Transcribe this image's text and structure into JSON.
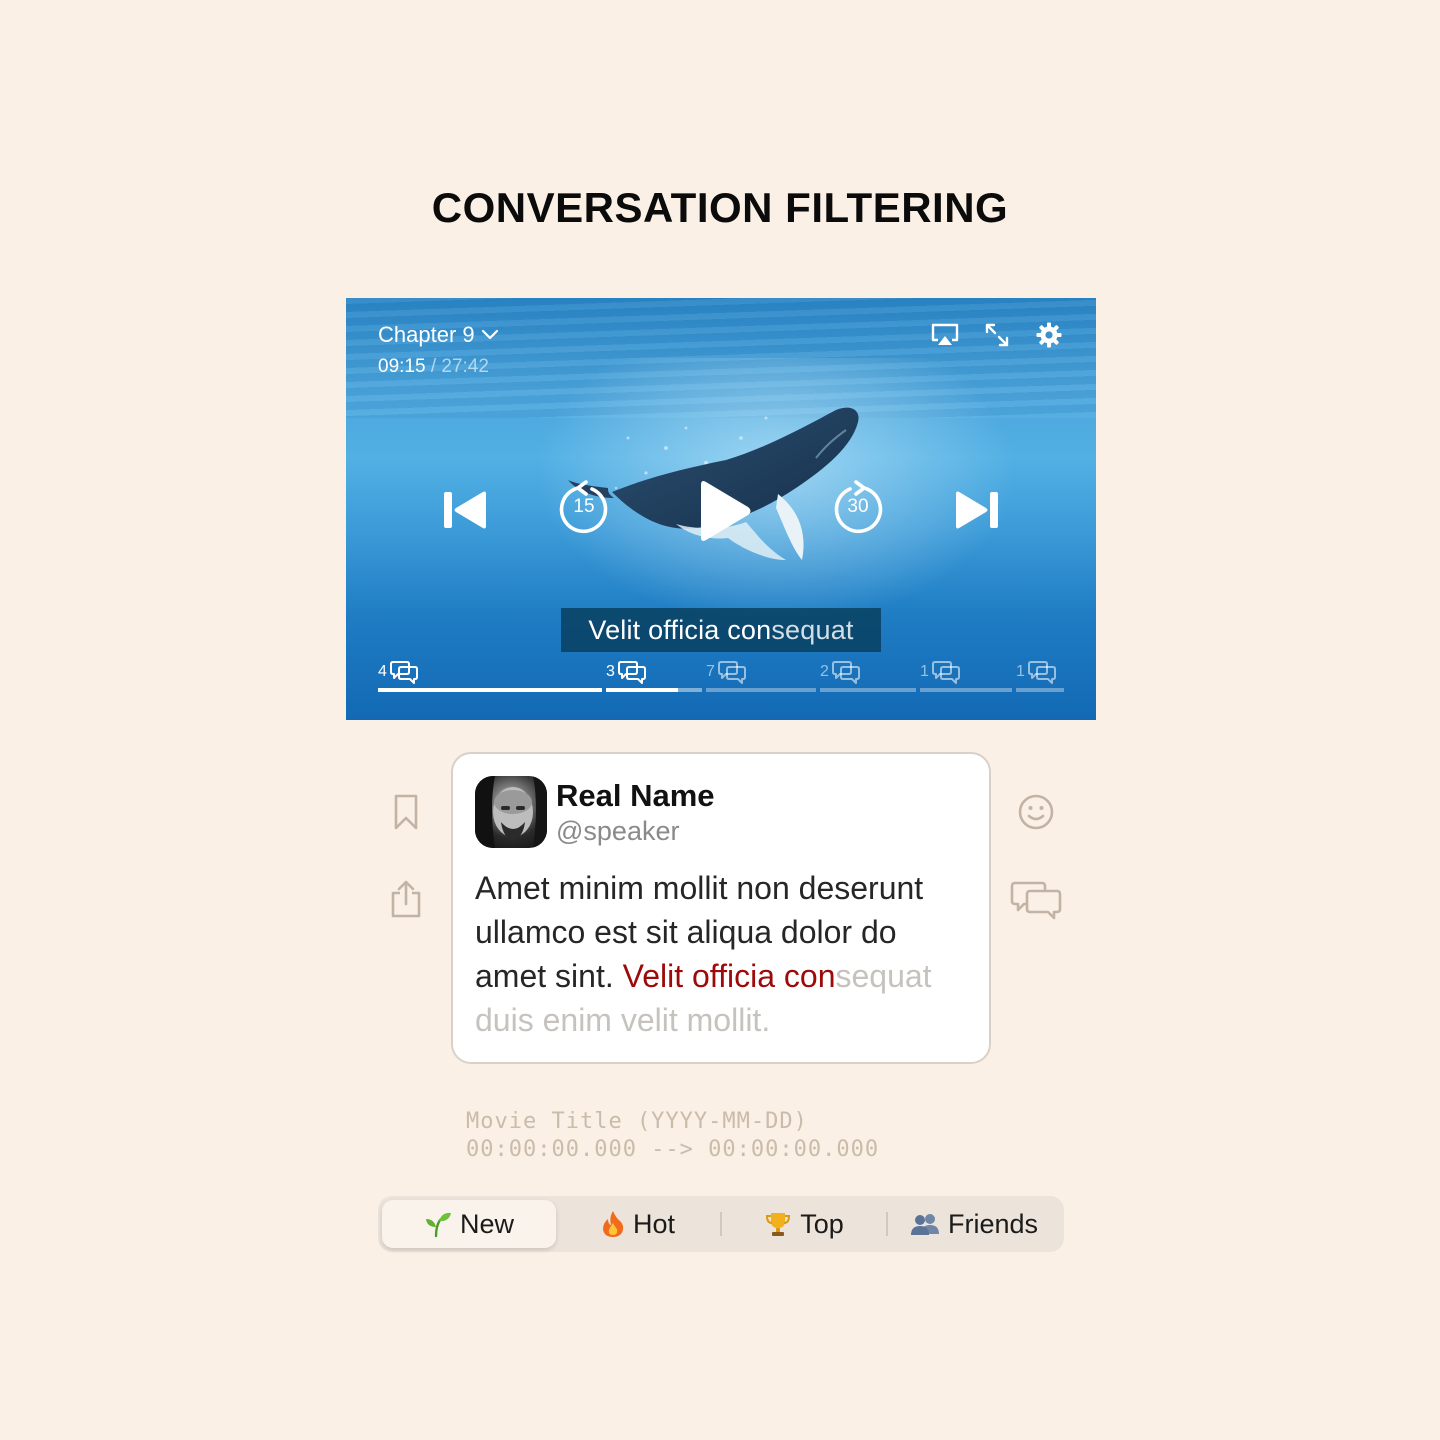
{
  "page": {
    "title": "CONVERSATION FILTERING"
  },
  "player": {
    "chapter_label": "Chapter 9",
    "current_time": "09:15",
    "time_separator": " / ",
    "total_time": "27:42",
    "rewind_seconds": "15",
    "forward_seconds": "30",
    "subtitle_highlight": "Velit officia con",
    "subtitle_rest": "sequat",
    "chapters": [
      {
        "count": "4",
        "state": "done",
        "progress": 1.0
      },
      {
        "count": "3",
        "state": "current",
        "progress": 0.75
      },
      {
        "count": "7",
        "state": "upcoming",
        "progress": 0
      },
      {
        "count": "2",
        "state": "upcoming",
        "progress": 0
      },
      {
        "count": "1",
        "state": "upcoming",
        "progress": 0
      },
      {
        "count": "1",
        "state": "upcoming",
        "progress": 0
      }
    ]
  },
  "comment": {
    "name": "Real Name",
    "handle": "@speaker",
    "body_plain": "Amet minim mollit non deserunt ullamco est sit aliqua dolor do amet sint. ",
    "body_highlight": "Velit officia con",
    "body_fade": "sequat duis enim velit mollit."
  },
  "subtitle_meta": {
    "line1": "Movie Title (YYYY-MM-DD)",
    "line2": "00:00:00.000 --> 00:00:00.000"
  },
  "filters": {
    "active": "new",
    "items": [
      {
        "id": "new",
        "label": "New",
        "icon": "seedling-icon"
      },
      {
        "id": "hot",
        "label": "Hot",
        "icon": "fire-icon"
      },
      {
        "id": "top",
        "label": "Top",
        "icon": "trophy-icon"
      },
      {
        "id": "friends",
        "label": "Friends",
        "icon": "people-icon"
      }
    ]
  },
  "colors": {
    "background": "#faf0e6",
    "highlight": "#9c0a0a",
    "side_icon": "#c2b3a4"
  }
}
